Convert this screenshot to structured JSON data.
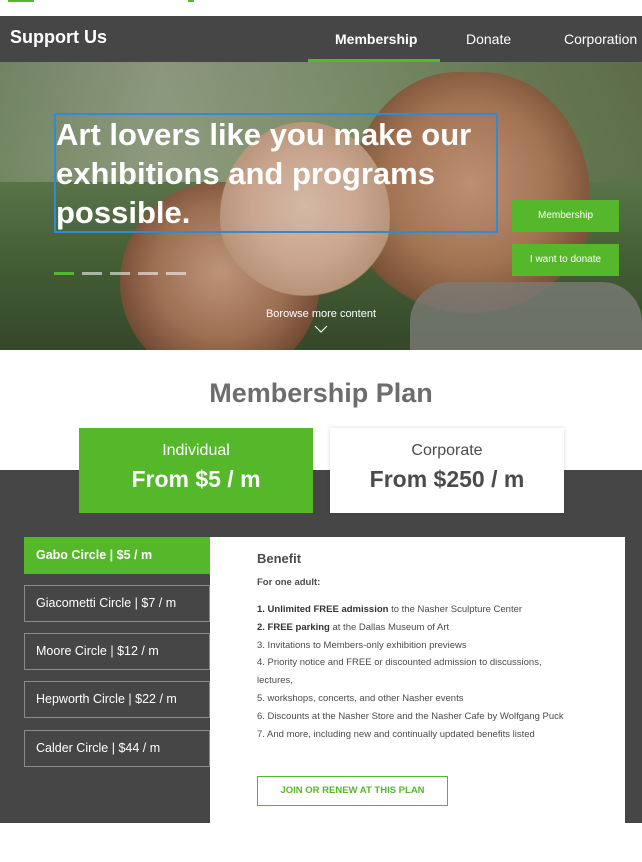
{
  "nav": {
    "title": "Support Us",
    "tabs": [
      {
        "label": "Membership",
        "active": true
      },
      {
        "label": "Donate",
        "active": false
      },
      {
        "label": "Corporation",
        "active": false
      }
    ]
  },
  "hero": {
    "headline": "Art lovers like you make our exhibitions and programs possible.",
    "buttons": {
      "membership": "Membership",
      "donate": "I want to donate"
    },
    "carousel": {
      "total": 5,
      "active_index": 0
    },
    "browse_label": "Borowse more content"
  },
  "plan": {
    "heading": "Membership Plan",
    "cards": [
      {
        "label": "Individual",
        "price": "From $5 / m",
        "selected": true
      },
      {
        "label": "Corporate",
        "price": "From $250 / m",
        "selected": false
      }
    ],
    "circles": [
      {
        "name": "Gabo Circle",
        "price": "$5 / m",
        "active": true
      },
      {
        "name": "Giacometti Circle",
        "price": "$7 / m",
        "active": false
      },
      {
        "name": "Moore Circle",
        "price": "$12 / m",
        "active": false
      },
      {
        "name": "Hepworth Circle",
        "price": "$22 / m",
        "active": false
      },
      {
        "name": "Calder Circle",
        "price": "$44 / m",
        "active": false
      }
    ],
    "benefit": {
      "title": "Benefit",
      "subtitle": "For one adult:",
      "items": [
        {
          "bold": "1. Unlimited FREE admission",
          "text": " to the Nasher Sculpture Center"
        },
        {
          "bold": "2. FREE parking",
          "text": " at the Dallas Museum of Art"
        },
        {
          "bold": "",
          "text": "3. Invitations to Members-only exhibition previews"
        },
        {
          "bold": "",
          "text": "4. Priority notice and FREE or discounted admission to discussions, lectures,"
        },
        {
          "bold": "",
          "text": "5. workshops, concerts, and other Nasher events"
        },
        {
          "bold": "",
          "text": "6. Discounts at the Nasher Store and the Nasher Cafe by Wolfgang Puck"
        },
        {
          "bold": "",
          "text": "7. And more, including new and continually updated benefits listed"
        }
      ],
      "button_label": "JOIN OR RENEW AT THIS PLAN"
    }
  },
  "colors": {
    "accent": "#55b82a",
    "nav_bg": "#464646",
    "focus_outline": "#2f8bd6",
    "heading_gray": "#6d6d6d"
  }
}
